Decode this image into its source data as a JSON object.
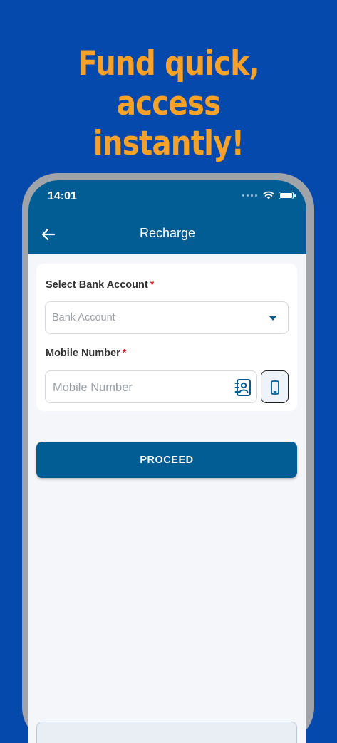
{
  "promo": {
    "headline_line1": "Fund quick, access",
    "headline_line2": "instantly!"
  },
  "status_bar": {
    "time": "14:01"
  },
  "app_bar": {
    "title": "Recharge"
  },
  "form": {
    "bank_label": "Select Bank Account",
    "required_mark": "*",
    "bank_placeholder": "Bank Account",
    "mobile_label": "Mobile Number",
    "mobile_placeholder": "Mobile Number",
    "mobile_value": ""
  },
  "actions": {
    "proceed_label": "PROCEED"
  },
  "icons": [
    "back-arrow-icon",
    "wifi-icon",
    "battery-icon",
    "chevron-down-icon",
    "contact-book-icon",
    "mobile-phone-icon"
  ],
  "colors": {
    "background": "#0649ad",
    "headline": "#f6a22a",
    "primary": "#035d95",
    "required": "#d32f2f"
  }
}
